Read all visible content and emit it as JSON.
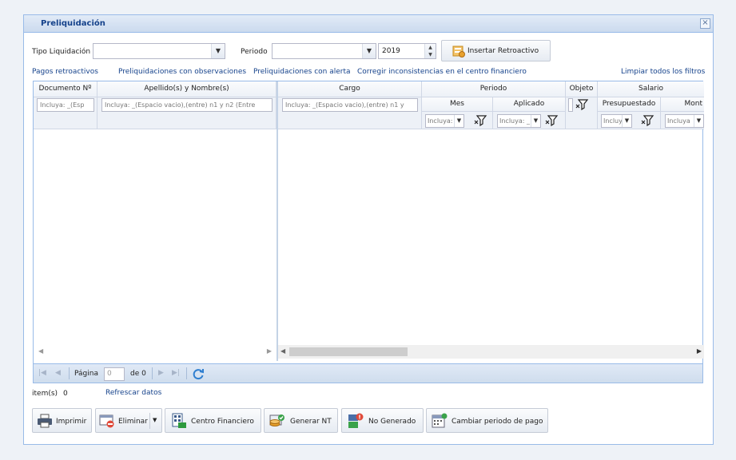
{
  "window": {
    "title": "Preliquidación",
    "close_label": "×"
  },
  "filters": {
    "tipo_liquidacion_label": "Tipo Liquidación",
    "tipo_liquidacion_value": "",
    "periodo_label": "Periodo",
    "periodo_value": "",
    "year": "2019",
    "insert_button": "Insertar Retroactivo"
  },
  "links": {
    "pagos": "Pagos retroactivos",
    "observaciones": "Preliquidaciones con observaciones",
    "alerta": "Preliquidaciones con alerta",
    "inconsistencias": "Corregir inconsistencias en el centro financiero",
    "limpiar": "Limpiar todos los filtros"
  },
  "grid": {
    "headers": {
      "documento": "Documento Nº",
      "apellido": "Apellido(s) y Nombre(s)",
      "cargo": "Cargo",
      "periodo": "Periodo",
      "mes": "Mes",
      "aplicado": "Aplicado",
      "objeto": "Objeto",
      "salario": "Salario",
      "presupuestado": "Presupuestado",
      "monto": "Mont"
    },
    "filters": {
      "documento": "Incluya: _(Esp",
      "apellido": "Incluya: _(Espacio vacio),(entre) n1 y n2 (Entre",
      "cargo": "Incluya: _(Espacio vacio),(entre) n1 y",
      "mes": "Incluya: _",
      "aplicado": "Incluya: _",
      "presupuestado": "Incluya",
      "monto": "Incluya"
    }
  },
  "paging": {
    "page_label": "Página",
    "page_value": "0",
    "of_label": "de 0"
  },
  "footer": {
    "items_label": "item(s)",
    "items_count": "0",
    "refresh": "Refrescar datos"
  },
  "actions": {
    "imprimir": "Imprimir",
    "eliminar": "Eliminar",
    "centro": "Centro Financiero",
    "generar": "Generar NT",
    "no_generado": "No Generado",
    "cambiar": "Cambiar periodo de pago"
  }
}
